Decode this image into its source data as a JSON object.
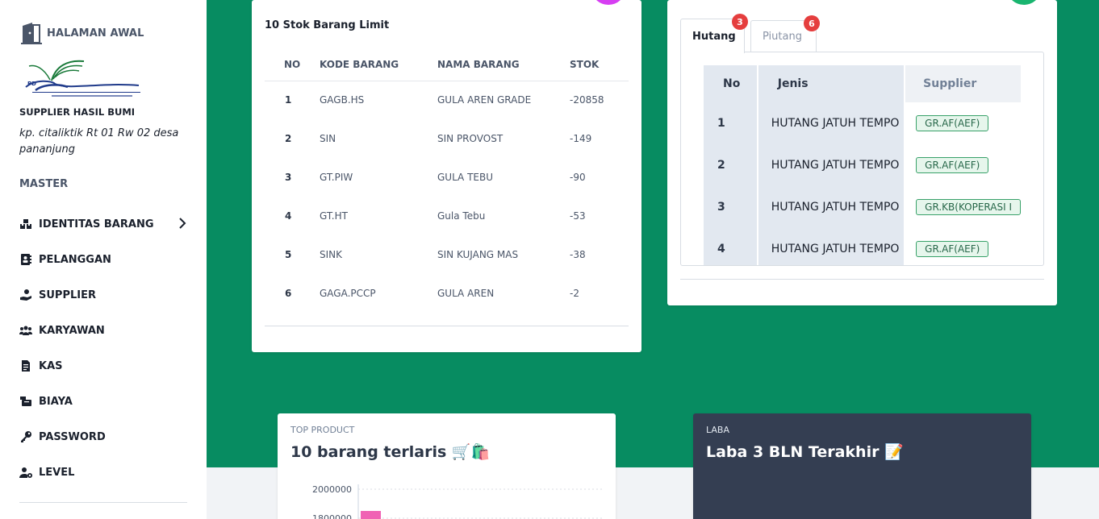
{
  "sidebar": {
    "brand_title": "HALAMAN AWAL",
    "company_name": "SUPPLIER HASIL BUMI",
    "company_address": "kp. citaliktik Rt 01 Rw 02 desa pananjung",
    "section_title": "MASTER",
    "items": [
      {
        "label": "IDENTITAS BARANG",
        "icon": "boxes-icon",
        "has_submenu": true
      },
      {
        "label": "PELANGGAN",
        "icon": "address-book-icon"
      },
      {
        "label": "SUPPLIER",
        "icon": "hand-holding-icon"
      },
      {
        "label": "KARYAWAN",
        "icon": "users-icon"
      },
      {
        "label": "KAS",
        "icon": "file-invoice-icon"
      },
      {
        "label": "BIAYA",
        "icon": "cash-register-icon"
      },
      {
        "label": "PASSWORD",
        "icon": "key-icon"
      },
      {
        "label": "LEVEL",
        "icon": "user-gear-icon"
      }
    ]
  },
  "stock_card": {
    "title": "10 Stok Barang Limit",
    "headers": [
      "NO",
      "KODE BARANG",
      "NAMA BARANG",
      "STOK"
    ],
    "rows": [
      {
        "no": "1",
        "kode": "GAGB.HS",
        "nama": "GULA AREN GRADE",
        "stok": "-20858"
      },
      {
        "no": "2",
        "kode": "SIN",
        "nama": "SIN PROVOST",
        "stok": "-149"
      },
      {
        "no": "3",
        "kode": "GT.PIW",
        "nama": "GULA TEBU",
        "stok": "-90"
      },
      {
        "no": "4",
        "kode": "GT.HT",
        "nama": "Gula Tebu",
        "stok": "-53"
      },
      {
        "no": "5",
        "kode": "SINK",
        "nama": "SIN KUJANG MAS",
        "stok": "-38"
      },
      {
        "no": "6",
        "kode": "GAGA.PCCP",
        "nama": "GULA AREN",
        "stok": "-2"
      }
    ]
  },
  "debt_card": {
    "tabs": [
      {
        "label": "Hutang",
        "badge": "3",
        "active": true
      },
      {
        "label": "Piutang",
        "badge": "6",
        "active": false
      }
    ],
    "headers": [
      "No",
      "Jenis",
      "Supplier"
    ],
    "rows": [
      {
        "no": "1",
        "jenis": "HUTANG JATUH TEMPO",
        "supplier": "GR.AF(AEF)"
      },
      {
        "no": "2",
        "jenis": "HUTANG JATUH TEMPO",
        "supplier": "GR.AF(AEF)"
      },
      {
        "no": "3",
        "jenis": "HUTANG JATUH TEMPO",
        "supplier": "GR.KB(KOPERASI I"
      },
      {
        "no": "4",
        "jenis": "HUTANG JATUH TEMPO",
        "supplier": "GR.AF(AEF)"
      }
    ]
  },
  "top_product": {
    "caption": "TOP PRODUCT",
    "title": "10 barang terlaris 🛒🛍️"
  },
  "laba": {
    "caption": "LABA",
    "title": "Laba 3 BLN Terakhir 📝"
  },
  "chart_data": {
    "type": "bar",
    "categories": [
      ""
    ],
    "values": [
      1850000
    ],
    "ylim": [
      1800000,
      2000000
    ],
    "y_ticks": [
      "2000000",
      "1800000"
    ],
    "colors": {
      "bar": "#f062b4"
    }
  },
  "colors": {
    "accent_green": "#078c61",
    "badge_red": "#e53e3e",
    "laba_card": "#343e52"
  }
}
